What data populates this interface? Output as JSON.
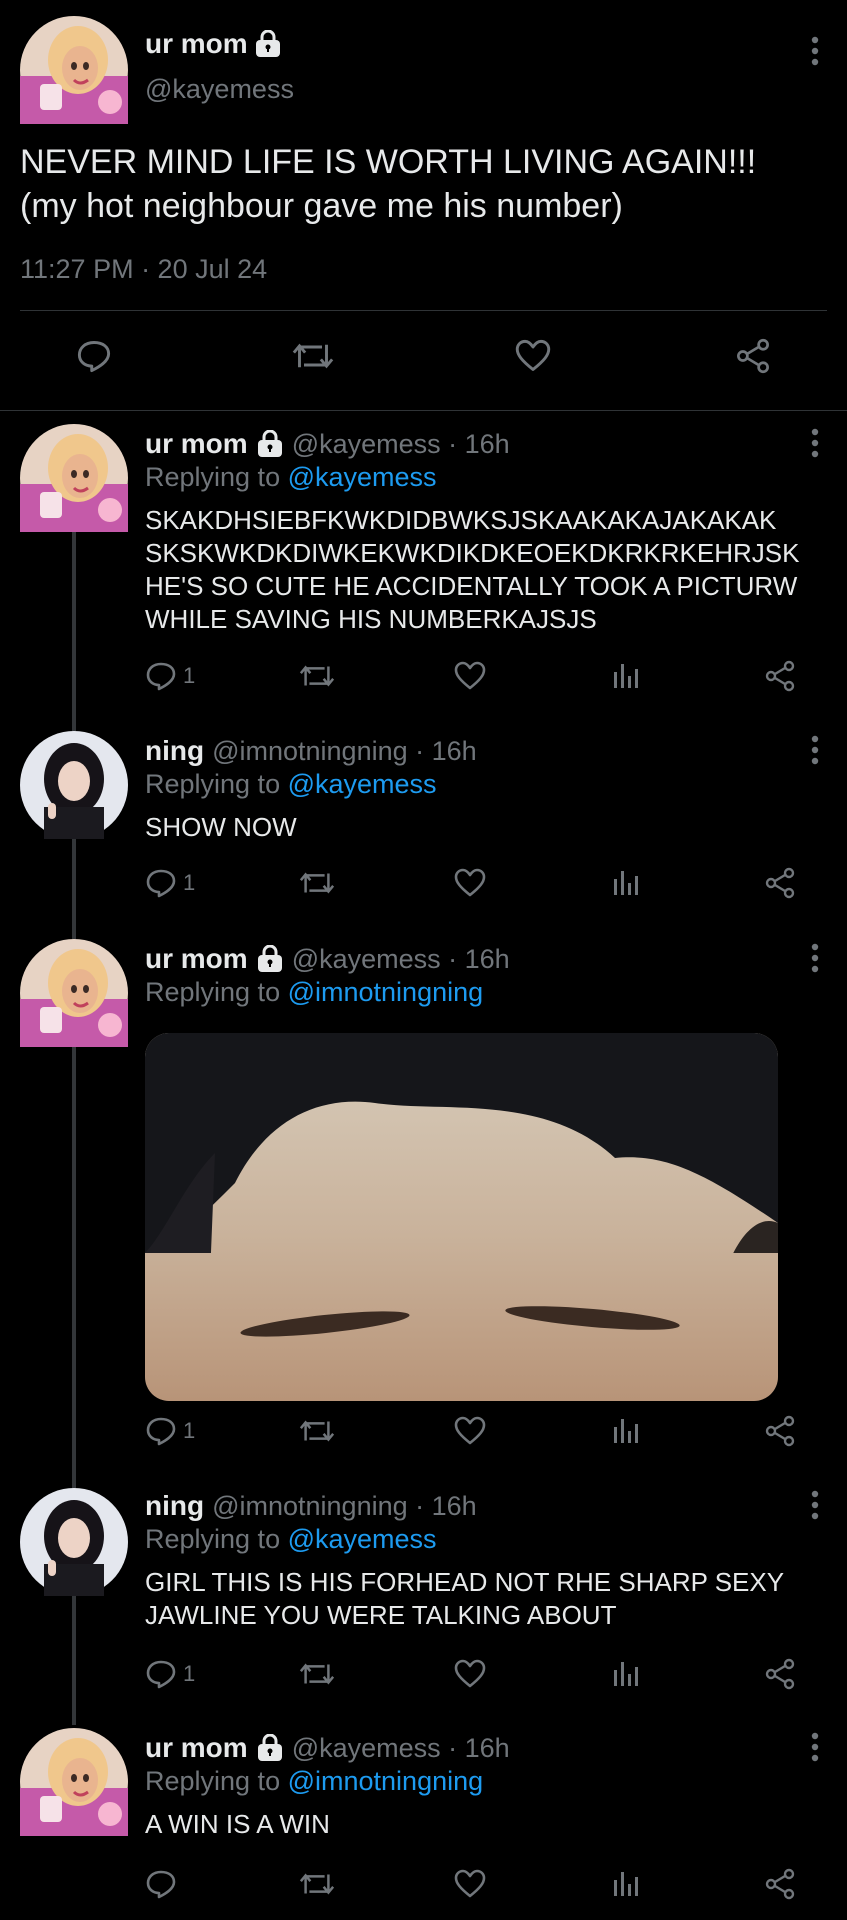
{
  "colors": {
    "background": "#000000",
    "text": "#e7e9ea",
    "muted": "#71767b",
    "link": "#1d9bf0",
    "divider": "#2f3336"
  },
  "main_tweet": {
    "name": "ur mom",
    "handle": "@kayemess",
    "text_line1": "NEVER MIND LIFE IS WORTH LIVING AGAIN!!!",
    "text_line2": "(my hot neighbour gave me his number)",
    "timestamp": "11:27 PM · 20 Jul 24",
    "icons": [
      "reply-icon",
      "retweet-icon",
      "like-icon",
      "share-icon"
    ]
  },
  "replies": [
    {
      "name": "ur mom",
      "handle": "@kayemess · 16h",
      "replying_prefix": "Replying to",
      "replying_to": "@kayemess",
      "text": "SKAKDHSIEBFKWKDIDBWKSJSKAAKAKAJAKAKAK\nSKSKWKDKDIWKEKWKDIKDKEOEKDKRKRKEHRJSK\nHE'S SO CUTE HE ACCIDENTALLY TOOK A PICTURW\nWHILE SAVING HIS NUMBERKAJSJS",
      "reply_count": "1",
      "avatar": "barbie-avatar"
    },
    {
      "name": "ning",
      "handle": "@imnotningning · 16h",
      "replying_prefix": "Replying to",
      "replying_to": "@kayemess",
      "text": "SHOW NOW",
      "reply_count": "1",
      "avatar": "ning-avatar"
    },
    {
      "name": "ur mom",
      "handle": "@kayemess · 16h",
      "replying_prefix": "Replying to",
      "replying_to": "@imnotningning",
      "text": "",
      "reply_count": "1",
      "avatar": "barbie-avatar",
      "has_photo": true
    },
    {
      "name": "ning",
      "handle": "@imnotningning · 16h",
      "replying_prefix": "Replying to",
      "replying_to": "@kayemess",
      "text": "GIRL THIS IS HIS FORHEAD NOT RHE SHARP SEXY\nJAWLINE YOU WERE TALKING ABOUT",
      "reply_count": "1",
      "avatar": "ning-avatar"
    },
    {
      "name": "ur mom",
      "handle": "@kayemess · 16h",
      "replying_prefix": "Replying to",
      "replying_to": "@imnotningning",
      "text": "A WIN IS A WIN",
      "reply_count": "",
      "avatar": "barbie-avatar"
    }
  ]
}
